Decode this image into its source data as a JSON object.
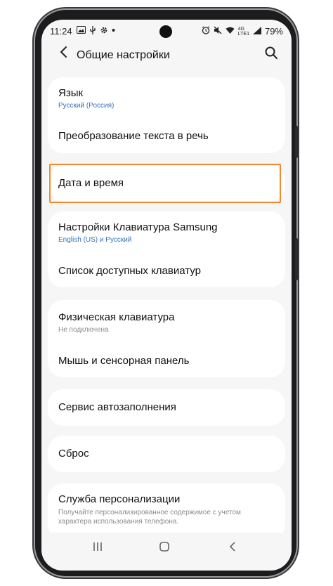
{
  "status_bar": {
    "time": "11:24",
    "battery": "79%",
    "network_top": "4G",
    "network_bottom": "LTE1"
  },
  "header": {
    "title": "Общие настройки"
  },
  "groups": [
    {
      "items": [
        {
          "title": "Язык",
          "subtitle": "Русский (Россия)"
        },
        {
          "title": "Преобразование текста в речь"
        }
      ]
    },
    {
      "items": [
        {
          "title": "Дата и время"
        }
      ]
    },
    {
      "items": [
        {
          "title": "Настройки Клавиатура Samsung",
          "subtitle": "English (US) и Русский"
        },
        {
          "title": "Список доступных клавиатур"
        }
      ]
    },
    {
      "items": [
        {
          "title": "Физическая клавиатура",
          "subtitle": "Не подключена"
        },
        {
          "title": "Мышь и сенсорная панель"
        }
      ]
    },
    {
      "items": [
        {
          "title": "Сервис автозаполнения"
        }
      ]
    },
    {
      "items": [
        {
          "title": "Сброс"
        }
      ]
    },
    {
      "items": [
        {
          "title": "Служба персонализации",
          "subtitle": "Получайте персонализированное содержимое с учетом характера использования телефона."
        }
      ]
    }
  ],
  "colors": {
    "highlight": "#f08a2c",
    "accent_subtitle": "#3a72b8"
  }
}
